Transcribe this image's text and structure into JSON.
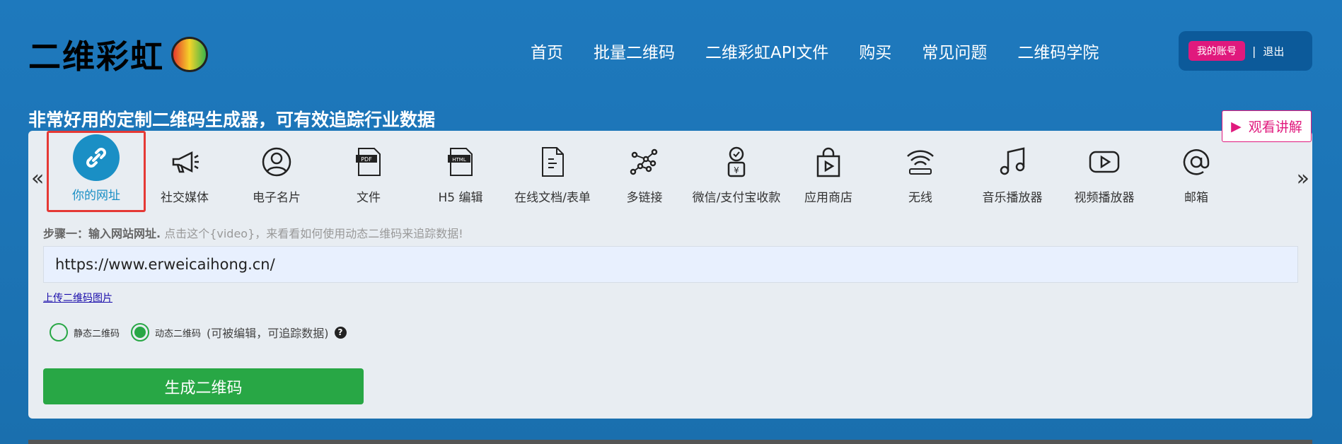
{
  "header": {
    "logo": "二维彩虹",
    "nav": [
      "首页",
      "批量二维码",
      "二维彩虹API文件",
      "购买",
      "常见问题",
      "二维码学院"
    ],
    "account": "我的账号",
    "separator": "|",
    "logout": "退出"
  },
  "tagline": "非常好用的定制二维码生成器，可有效追踪行业数据",
  "watch_button": "观看讲解",
  "types": [
    {
      "label": "你的网址",
      "icon": "link-icon"
    },
    {
      "label": "社交媒体",
      "icon": "megaphone-icon"
    },
    {
      "label": "电子名片",
      "icon": "user-circle-icon"
    },
    {
      "label": "文件",
      "icon": "pdf-icon"
    },
    {
      "label": "H5 编辑",
      "icon": "html-icon"
    },
    {
      "label": "在线文档/表单",
      "icon": "document-icon"
    },
    {
      "label": "多链接",
      "icon": "multi-link-icon"
    },
    {
      "label": "微信/支付宝收款",
      "icon": "payment-icon"
    },
    {
      "label": "应用商店",
      "icon": "store-bag-icon"
    },
    {
      "label": "无线",
      "icon": "wifi-icon"
    },
    {
      "label": "音乐播放器",
      "icon": "music-icon"
    },
    {
      "label": "视频播放器",
      "icon": "video-icon"
    },
    {
      "label": "邮箱",
      "icon": "at-icon"
    }
  ],
  "step": {
    "bold": "步骤一：输入网站网址.",
    "hint": "点击这个{video}，来看看如何使用动态二维码来追踪数据!"
  },
  "url_value": "https://www.erweicaihong.cn/",
  "upload_link": "上传二维码图片",
  "radios": {
    "static": "静态二维码",
    "dynamic": "动态二维码",
    "dynamic_hint": "(可被编辑，可追踪数据)",
    "selected": "dynamic"
  },
  "generate": "生成二维码",
  "colors": {
    "accent": "#1a8fc5",
    "pink": "#e0197d",
    "green": "#28a745"
  }
}
